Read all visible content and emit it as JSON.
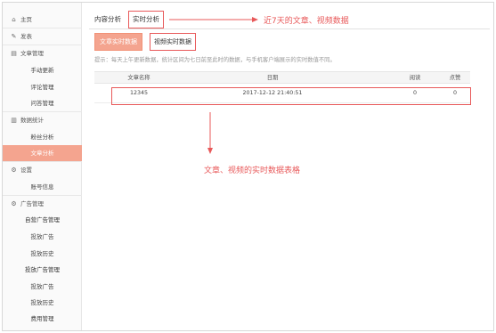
{
  "sidebar": {
    "items": [
      {
        "label": "主页",
        "icon": "home-icon",
        "glyph": "⌂"
      },
      {
        "label": "发表",
        "icon": "edit-icon",
        "glyph": "✎"
      },
      {
        "label": "文章管理",
        "icon": "document-icon",
        "glyph": "▤"
      },
      {
        "label": "手动更新"
      },
      {
        "label": "评论管理"
      },
      {
        "label": "问答管理"
      },
      {
        "label": "数据统计",
        "icon": "bar-chart-icon",
        "glyph": "▥"
      },
      {
        "label": "粉丝分析"
      },
      {
        "label": "文章分析"
      },
      {
        "label": "设置",
        "icon": "gear-icon",
        "glyph": "⚙"
      },
      {
        "label": "账号信息"
      },
      {
        "label": "广告管理",
        "icon": "ad-icon",
        "glyph": "⚙"
      },
      {
        "label": "自营广告管理"
      },
      {
        "label": "投放广告"
      },
      {
        "label": "投放历史"
      },
      {
        "label": "投放广告管理"
      },
      {
        "label": "投放广告"
      },
      {
        "label": "投放历史"
      },
      {
        "label": "费用管理"
      }
    ]
  },
  "tabs": [
    {
      "label": "内容分析"
    },
    {
      "label": "实时分析"
    }
  ],
  "subtabs": [
    {
      "label": "文章实时数据"
    },
    {
      "label": "视频实时数据"
    }
  ],
  "tip": "提示：每天上午更新数据，统计区间为七日前至此时的数据，与手机客户端展示的实时数值不同。",
  "table": {
    "columns": [
      "文章名称",
      "日期",
      "阅读",
      "点赞"
    ],
    "rows": [
      [
        "12345",
        "2017-12-12 21:40:51",
        "0",
        "0"
      ]
    ]
  },
  "annotations": {
    "top": "近7天的文章、视频数据",
    "bottom": "文章、视频的实时数据表格"
  },
  "colors": {
    "accent": "#f4a48f",
    "annotation": "#e8595a"
  }
}
